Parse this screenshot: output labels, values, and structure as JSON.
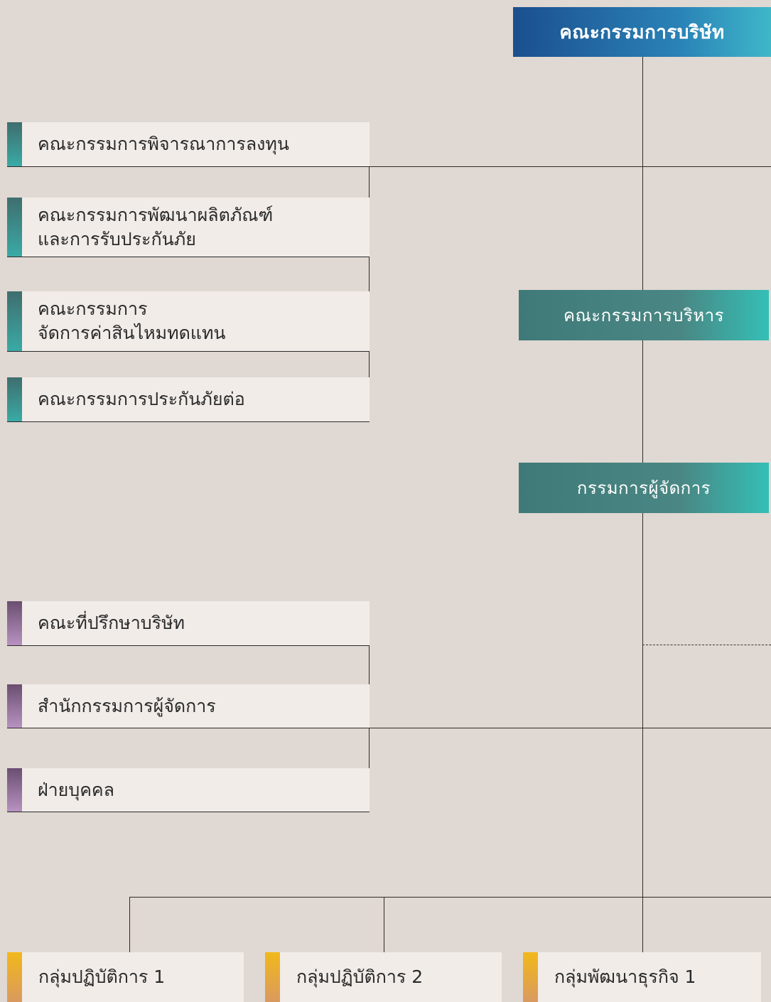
{
  "top": {
    "label": "คณะกรรมการบริษัท"
  },
  "executive": {
    "label": "คณะกรรมการบริหาร"
  },
  "managing_director": {
    "label": "กรรมการผู้จัดการ"
  },
  "board_committees": [
    {
      "lines": [
        "คณะกรรมการพิจารณาการลงทุน"
      ]
    },
    {
      "lines": [
        "คณะกรรมการพัฒนาผลิตภัณฑ์",
        "และการรับประกันภัย"
      ]
    },
    {
      "lines": [
        "คณะกรรมการ",
        "จัดการค่าสินไหมทดแทน"
      ]
    },
    {
      "lines": [
        "คณะกรรมการประกันภัยต่อ"
      ]
    }
  ],
  "staff_units": [
    {
      "label": "คณะที่ปรึกษาบริษัท"
    },
    {
      "label": "สำนักกรรมการผู้จัดการ"
    },
    {
      "label": "ฝ่ายบุคคล"
    }
  ],
  "groups": [
    {
      "label": "กลุ่มปฏิบัติการ 1"
    },
    {
      "label": "กลุ่มปฏิบัติการ 2"
    },
    {
      "label": "กลุ่มพัฒนาธุรกิจ 1"
    }
  ],
  "colors": {
    "background": "#e0d8d2",
    "board": "#1b4f8e",
    "executive": "#4a8784",
    "accent_committee": "#3aaaa6",
    "accent_staff": "#8a6a94",
    "accent_group": "#f2b819"
  }
}
